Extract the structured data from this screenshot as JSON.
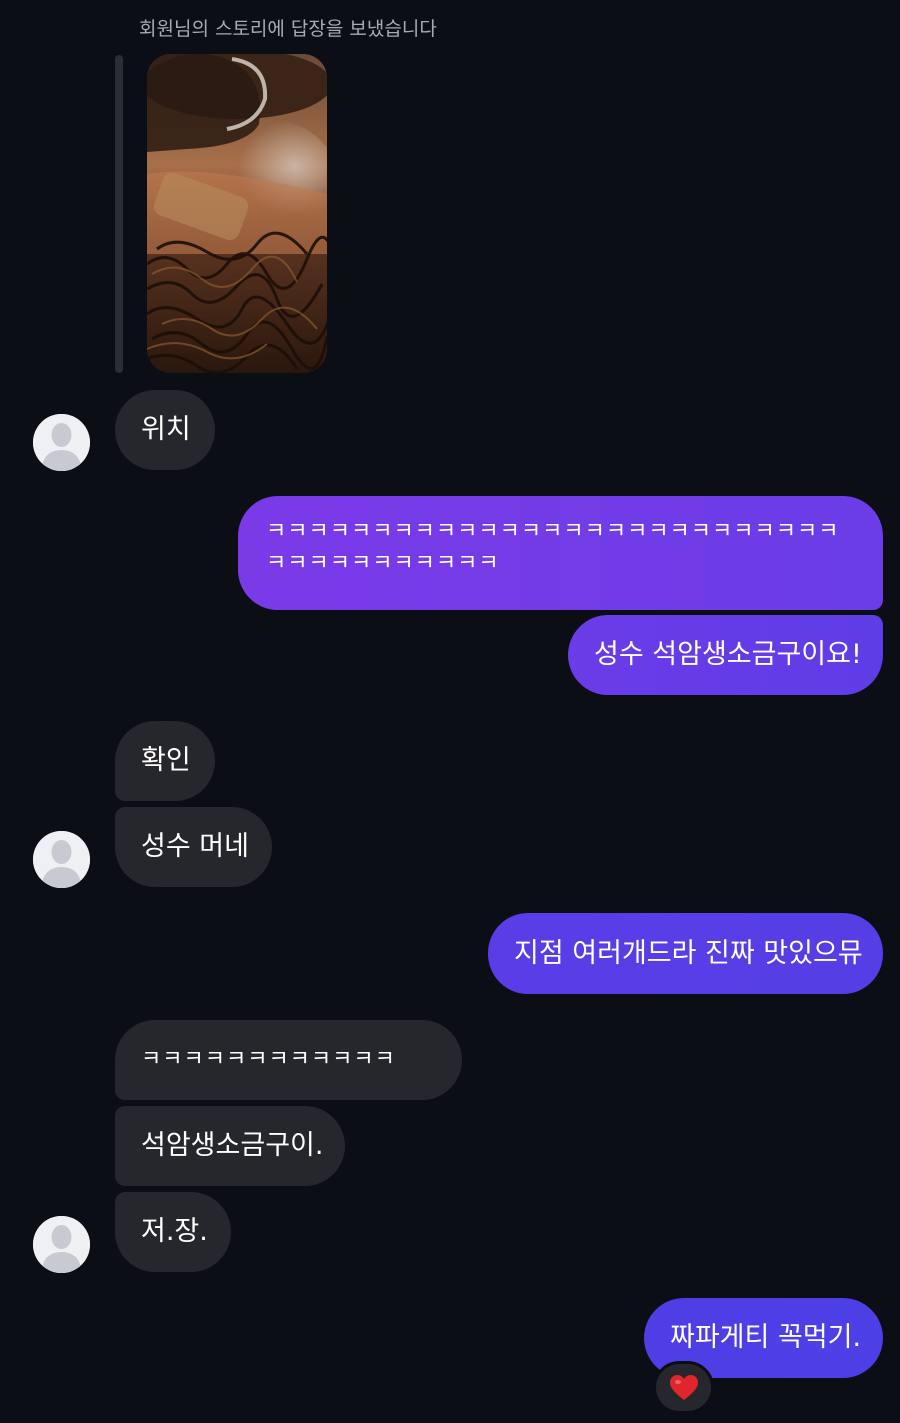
{
  "story_reply": {
    "caption": "회원님의 스토리에 답장을 보냈습니다",
    "thumbnail_icon": "story-food-thumbnail"
  },
  "messages": [
    {
      "side": "received",
      "text": "위치"
    },
    {
      "side": "sent",
      "text": "ㅋㅋㅋㅋㅋㅋㅋㅋㅋㅋㅋㅋㅋㅋㅋㅋㅋㅋㅋㅋㅋㅋㅋㅋㅋㅋㅋㅋㅋㅋㅋㅋㅋㅋㅋㅋㅋㅋ"
    },
    {
      "side": "sent",
      "text": "성수 석암생소금구이요!"
    },
    {
      "side": "received",
      "text": "확인"
    },
    {
      "side": "received",
      "text": "성수 머네"
    },
    {
      "side": "sent",
      "text": "지점 여러개드라 진짜 맛있으뮤"
    },
    {
      "side": "received",
      "text": "ㅋㅋㅋㅋㅋㅋㅋㅋㅋㅋㅋㅋ"
    },
    {
      "side": "received",
      "text": "석암생소금구이."
    },
    {
      "side": "received",
      "text": "저.장."
    },
    {
      "side": "sent",
      "text": "짜파게티 꼭먹기.",
      "reaction": "❤️"
    }
  ],
  "colors": {
    "background": "#0b0e14",
    "received_bubble": "#25272d",
    "sent_gradient_top": "#7b3ae8",
    "sent_gradient_bottom": "#5b3de6",
    "reaction_heart": "#e0262d"
  },
  "icons": {
    "avatar": "default-profile-avatar-icon",
    "reaction": "red-heart-icon"
  }
}
